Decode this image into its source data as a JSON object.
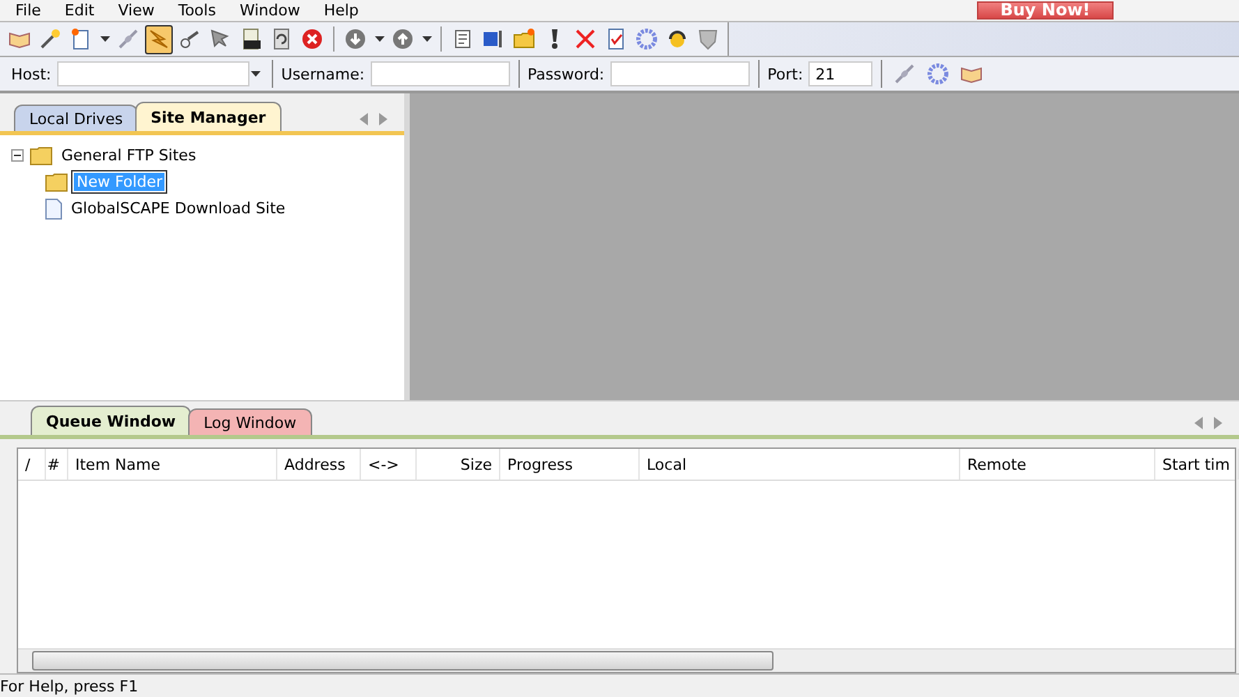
{
  "menu": [
    "File",
    "Edit",
    "View",
    "Tools",
    "Window",
    "Help"
  ],
  "buy_button": "Buy Now!",
  "toolbar": [
    {
      "kind": "book",
      "selected": false
    },
    {
      "kind": "wand",
      "selected": false
    },
    {
      "kind": "newfile",
      "selected": false
    },
    {
      "kind": "dropdown",
      "selected": false
    },
    {
      "kind": "plug",
      "selected": false
    },
    {
      "kind": "bolt",
      "selected": true
    },
    {
      "kind": "disconnect",
      "selected": false
    },
    {
      "kind": "arrowback",
      "selected": false
    },
    {
      "kind": "url",
      "selected": false
    },
    {
      "kind": "refresh",
      "selected": false
    },
    {
      "kind": "stop",
      "selected": false
    },
    {
      "kind": "sep"
    },
    {
      "kind": "download",
      "selected": false
    },
    {
      "kind": "dropdown",
      "selected": false
    },
    {
      "kind": "upload",
      "selected": false
    },
    {
      "kind": "dropdown",
      "selected": false
    },
    {
      "kind": "sep"
    },
    {
      "kind": "notes",
      "selected": false
    },
    {
      "kind": "rename",
      "selected": false
    },
    {
      "kind": "newfolder",
      "selected": false
    },
    {
      "kind": "exclaim",
      "selected": false
    },
    {
      "kind": "delete",
      "selected": false
    },
    {
      "kind": "check",
      "selected": false
    },
    {
      "kind": "gear",
      "selected": false
    },
    {
      "kind": "headset",
      "selected": false
    },
    {
      "kind": "shield",
      "selected": false
    }
  ],
  "connect_bar": {
    "host_label": "Host:",
    "username_label": "Username:",
    "password_label": "Password:",
    "port_label": "Port:",
    "port_value": "21"
  },
  "left_tabs": [
    {
      "label": "Local Drives",
      "selected": false
    },
    {
      "label": "Site Manager",
      "selected": true
    }
  ],
  "tree": [
    {
      "label": "General FTP Sites",
      "kind": "folder",
      "expanded": true,
      "editing": false,
      "children": [
        {
          "label": "New Folder",
          "kind": "folder",
          "editing": true
        },
        {
          "label": "GlobalSCAPE Download Site",
          "kind": "site",
          "editing": false
        }
      ]
    }
  ],
  "bottom_tabs": [
    {
      "label": "Queue Window",
      "selected": true
    },
    {
      "label": "Log Window",
      "selected": false
    }
  ],
  "queue_columns": [
    "/",
    "#",
    "Item Name",
    "Address",
    "<->",
    "Size",
    "Progress",
    "Local",
    "Remote",
    "Start tim"
  ],
  "status_bar": {
    "text": "For Help, press F1"
  }
}
